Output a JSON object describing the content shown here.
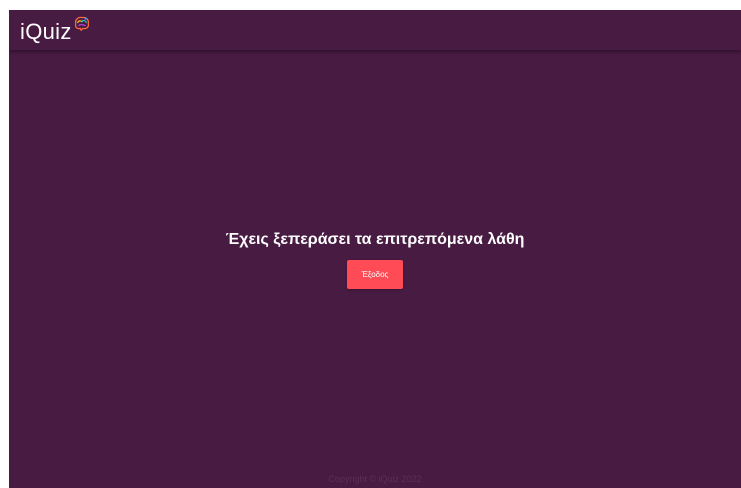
{
  "app": {
    "brand_name": "iQuiz",
    "logo_icon": "colorful-brain-icon"
  },
  "main": {
    "message": "Έχεις ξεπεράσει τα επιτρεπόμενα λάθη",
    "exit_button_label": "Έξοδος"
  },
  "footer": {
    "copyright": "Copyright © iQuiz 2022"
  },
  "colors": {
    "background": "#481b42",
    "accent_button": "#ff4b56",
    "text": "#ffffff",
    "footer_text": "#5d2f55"
  }
}
